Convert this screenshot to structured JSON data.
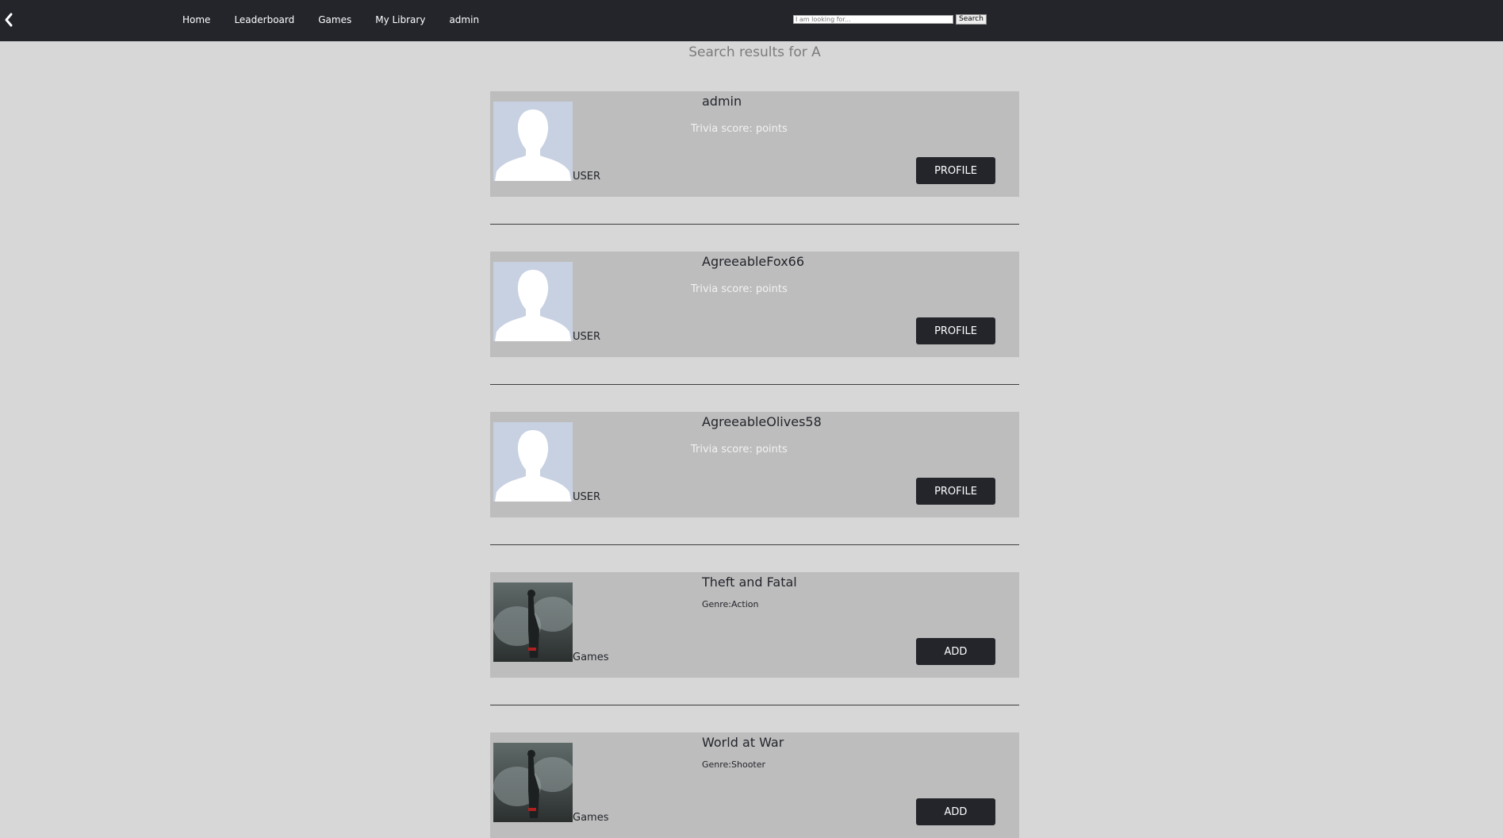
{
  "nav": {
    "back_icon": "chevron-left-icon",
    "links": [
      "Home",
      "Leaderboard",
      "Games",
      "My Library",
      "admin"
    ],
    "search": {
      "placeholder": "I am looking for...",
      "value": "",
      "button_label": "Search"
    }
  },
  "results_title": "Search results for A",
  "results": [
    {
      "kind": "user",
      "name": "admin",
      "subtitle": "Trivia score: points",
      "type_label": "USER",
      "button_label": "PROFILE",
      "image": "default-avatar"
    },
    {
      "kind": "user",
      "name": "AgreeableFox66",
      "subtitle": "Trivia score: points",
      "type_label": "USER",
      "button_label": "PROFILE",
      "image": "default-avatar"
    },
    {
      "kind": "user",
      "name": "AgreeableOlives58",
      "subtitle": "Trivia score: points",
      "type_label": "USER",
      "button_label": "PROFILE",
      "image": "default-avatar"
    },
    {
      "kind": "game",
      "name": "Theft and Fatal",
      "subtitle": "Genre:Action",
      "type_label": "Games",
      "button_label": "ADD",
      "image": "game-cover"
    },
    {
      "kind": "game",
      "name": "World at War",
      "subtitle": "Genre:Shooter",
      "type_label": "Games",
      "button_label": "ADD",
      "image": "game-cover"
    }
  ],
  "colors": {
    "navbar": "#23252b",
    "background": "#d7d7d7",
    "card": "#bdbdbd",
    "button": "#23252b"
  }
}
